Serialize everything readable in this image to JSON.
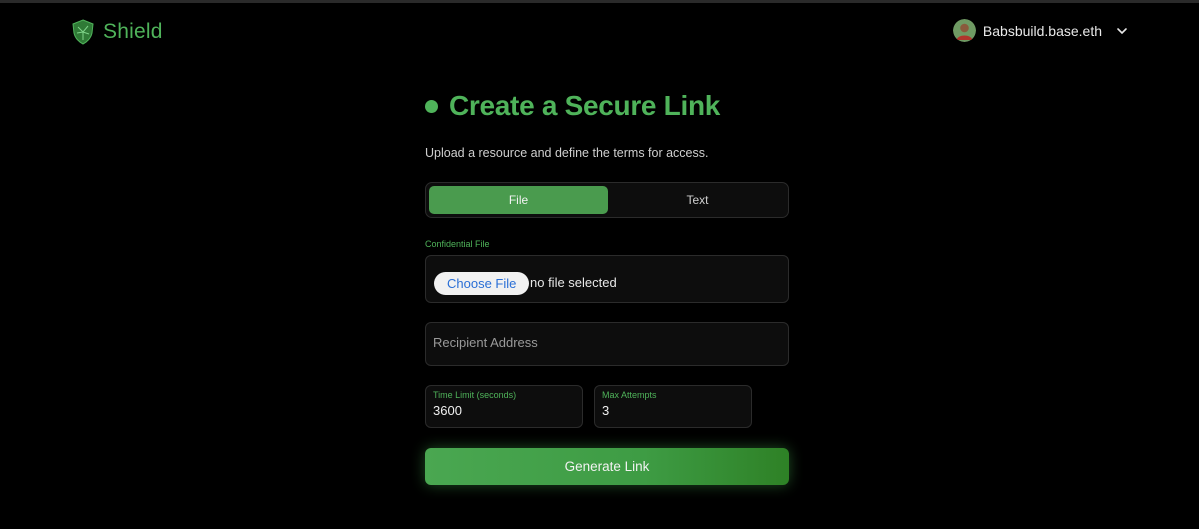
{
  "header": {
    "brand": "Shield",
    "logo_icon": "shield-icon",
    "user_name": "Babsbuild.base.eth",
    "avatar": "avatar",
    "menu_icon": "chevron-down-icon"
  },
  "main": {
    "title": "Create a Secure Link",
    "subtitle": "Upload a resource and define the terms for access.",
    "tabs": [
      {
        "label": "File",
        "active": true
      },
      {
        "label": "Text",
        "active": false
      }
    ],
    "file_field": {
      "label": "Confidential File",
      "button_label": "Choose File",
      "status": "no file selected"
    },
    "recipient": {
      "placeholder": "Recipient Address",
      "value": ""
    },
    "time_limit": {
      "label": "Time Limit (seconds)",
      "value": "3600"
    },
    "max_attempts": {
      "label": "Max Attempts",
      "value": "3"
    },
    "submit_label": "Generate Link"
  },
  "colors": {
    "accent": "#4fb35a",
    "active_tab": "#4a9b4e",
    "background": "#000000",
    "field_border": "#2b2b2b"
  }
}
